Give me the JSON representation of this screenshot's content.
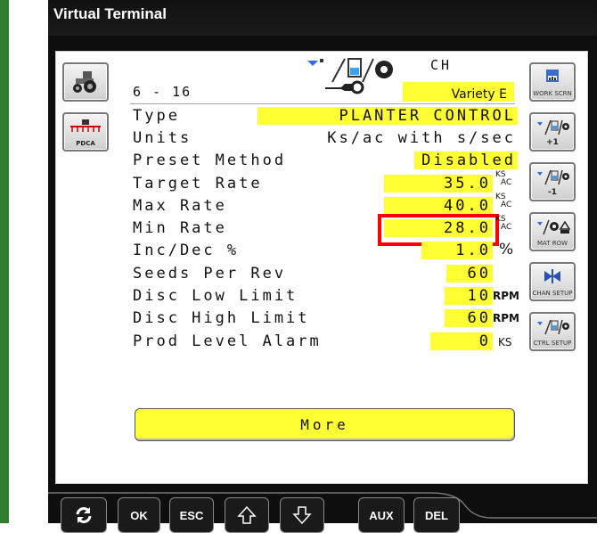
{
  "window": {
    "title": "Virtual Terminal"
  },
  "header": {
    "channel_code": "CH",
    "range": "6 - 16",
    "variety": "Variety E"
  },
  "left_softkeys": [
    {
      "icon": "tractor-icon",
      "label": ""
    },
    {
      "icon": "planter-icon",
      "label": "PDCA"
    }
  ],
  "right_softkeys": [
    {
      "icon": "work-screen-icon",
      "label": "WORK SCRN"
    },
    {
      "icon": "increment-icon",
      "label": "+1"
    },
    {
      "icon": "decrement-icon",
      "label": "-1"
    },
    {
      "icon": "material-row-icon",
      "label": "MAT ROW"
    },
    {
      "icon": "channel-setup-icon",
      "label": "CHAN SETUP"
    },
    {
      "icon": "control-setup-icon",
      "label": "CTRL SETUP"
    }
  ],
  "rows": [
    {
      "label": "Type",
      "value": "PLANTER CONTROL",
      "unit": ""
    },
    {
      "label": "Units",
      "value": "Ks/ac with s/sec",
      "unit": ""
    },
    {
      "label": "Preset Method",
      "value": "Disabled",
      "unit": ""
    },
    {
      "label": "Target Rate",
      "value": "35.0",
      "unit_top": "KS",
      "unit_bottom": "AC"
    },
    {
      "label": "Max Rate",
      "value": "40.0",
      "unit_top": "KS",
      "unit_bottom": "AC"
    },
    {
      "label": "Min Rate",
      "value": "28.0",
      "unit_top": "KS",
      "unit_bottom": "AC"
    },
    {
      "label": "Inc/Dec %",
      "value": "1.0",
      "unit": "%"
    },
    {
      "label": "Seeds Per Rev",
      "value": "60",
      "unit": ""
    },
    {
      "label": "Disc Low Limit",
      "value": "10",
      "unit": "RPM"
    },
    {
      "label": "Disc High Limit",
      "value": "60",
      "unit": "RPM"
    },
    {
      "label": "Prod Level Alarm",
      "value": "0",
      "unit": "KS"
    }
  ],
  "more_button": "More",
  "bottom_buttons": {
    "refresh": "",
    "ok": "OK",
    "esc": "ESC",
    "aux": "AUX",
    "del": "DEL"
  },
  "colors": {
    "highlight": "#ffff33",
    "selection_border": "#ff0000",
    "side_bar": "#2f7d2f"
  }
}
